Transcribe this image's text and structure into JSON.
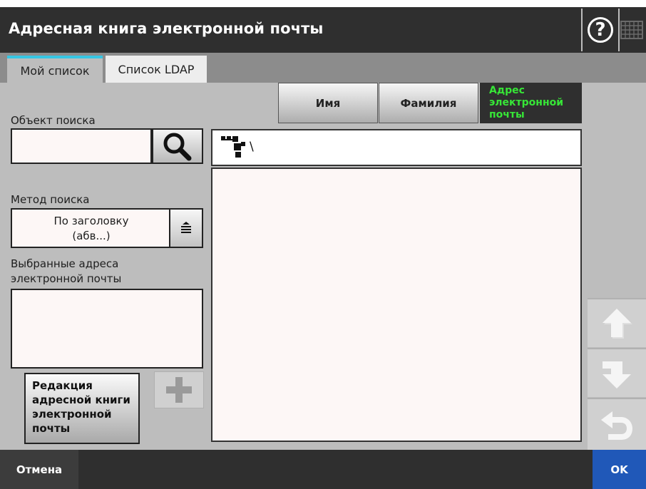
{
  "window": {
    "title": "Адресная книга электронной почты",
    "help_glyph": "?",
    "help_icon": "help-circle-icon",
    "keyboard_icon": "keyboard-icon"
  },
  "tabs": [
    {
      "label": "Мой список",
      "active": true
    },
    {
      "label": "Список LDAP",
      "active": false
    }
  ],
  "search": {
    "label": "Объект поиска",
    "value": "",
    "button_icon": "search-icon"
  },
  "method": {
    "label": "Метод поиска",
    "selected": "По заголовку\n(абв...)",
    "dropdown_icon": "list-dropdown-icon"
  },
  "selected_addresses": {
    "label": "Выбранные адреса\nэлектронной почты"
  },
  "edit_button": {
    "label": "Редакция\nадресной книги\nэлектронной\nпочты"
  },
  "add_button": {
    "icon": "plus-icon"
  },
  "columns": {
    "name": "Имя",
    "surname": "Фамилия",
    "email": "Адрес\nэлектронной\nпочты",
    "active_color": "#37e637"
  },
  "path": {
    "icon": "tree-icon",
    "text": "\\"
  },
  "nav": {
    "up_icon": "arrow-up-icon",
    "down_icon": "arrow-down-icon",
    "back_icon": "return-icon"
  },
  "footer": {
    "cancel": "Отмена",
    "ok": "OK"
  },
  "colors": {
    "header_bg": "#2f2f2f",
    "panel_bg": "#bdbdbd",
    "accent_tab": "#36c6e3",
    "ok_bg": "#2058b8"
  }
}
